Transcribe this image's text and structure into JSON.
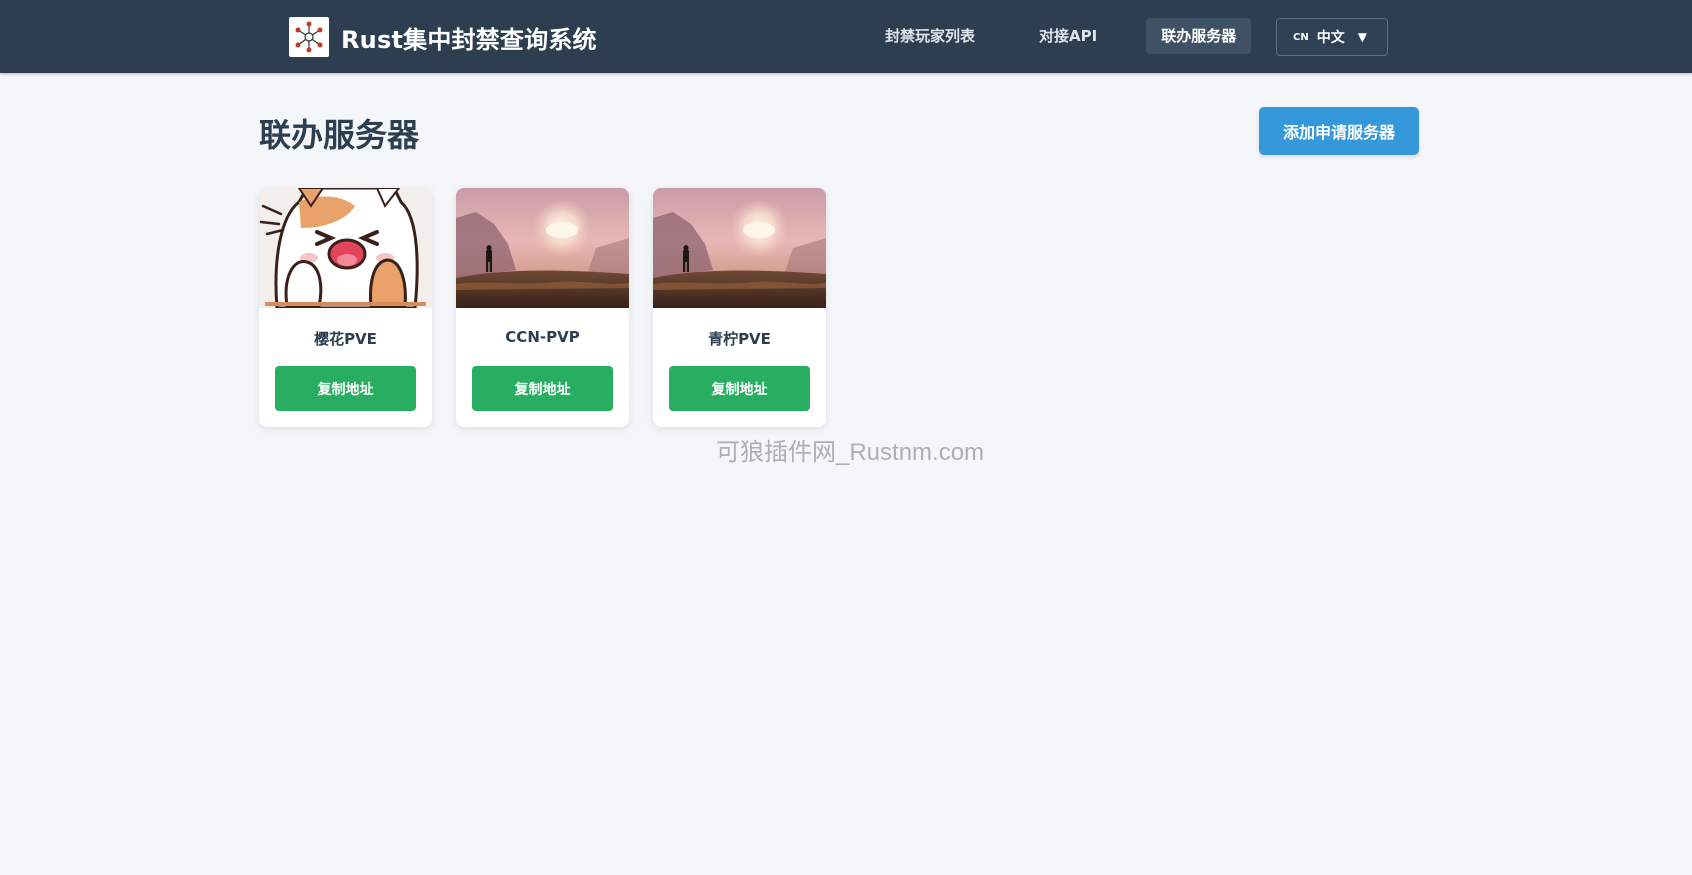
{
  "header": {
    "app_title": "Rust集中封禁查询系统",
    "logo_icon": "network-nodes-icon",
    "nav": [
      {
        "label": "封禁玩家列表",
        "active": false
      },
      {
        "label": "对接API",
        "active": false
      },
      {
        "label": "联办服务器",
        "active": true
      }
    ],
    "language": {
      "code": "CN",
      "label": "中文",
      "caret": "▼"
    }
  },
  "page": {
    "title": "联办服务器",
    "add_button": "添加申请服务器"
  },
  "servers": [
    {
      "name": "樱花PVE",
      "copy_label": "复制地址",
      "thumbnail": "cartoon-cat-image"
    },
    {
      "name": "CCN-PVP",
      "copy_label": "复制地址",
      "thumbnail": "sunset-landscape-image"
    },
    {
      "name": "青柠PVE",
      "copy_label": "复制地址",
      "thumbnail": "sunset-landscape-image"
    }
  ],
  "watermark": "可狼插件网_Rustnm.com",
  "colors": {
    "navbar": "#2c3e50",
    "primary": "#3498db",
    "success": "#27ae60",
    "background": "#f4f6fa"
  }
}
